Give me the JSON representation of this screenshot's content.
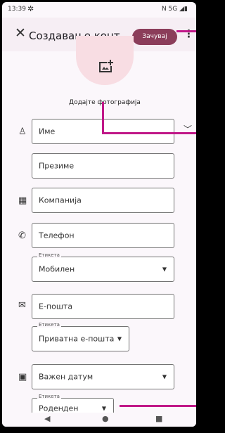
{
  "status_bar": {
    "time": "13:39",
    "network": "N 5G"
  },
  "header": {
    "title": "Создавање конт...",
    "save_label": "Зачувај"
  },
  "photo": {
    "add_label": "Додајте фотографија"
  },
  "fields": {
    "first_name": "Име",
    "last_name": "Презиме",
    "company": "Компанија",
    "phone": "Телефон",
    "phone_label_caption": "Етикета",
    "phone_label": "Мобилен",
    "email": "Е-пошта",
    "email_label_caption": "Етикета",
    "email_label": "Приватна е-пошта",
    "date": "Важен датум",
    "date_label_caption": "Етикета",
    "date_label": "Роденден"
  },
  "icons": {
    "close": "close-icon",
    "more": "more-vert-icon",
    "add_photo": "add-photo-icon",
    "person": "person-icon",
    "company": "business-icon",
    "phone": "phone-icon",
    "email": "email-icon",
    "event": "calendar-icon",
    "expand": "chevron-down-icon"
  },
  "colors": {
    "accent": "#8b3d5a",
    "annotation": "#c01888",
    "photo_bg": "#f8dde3"
  }
}
